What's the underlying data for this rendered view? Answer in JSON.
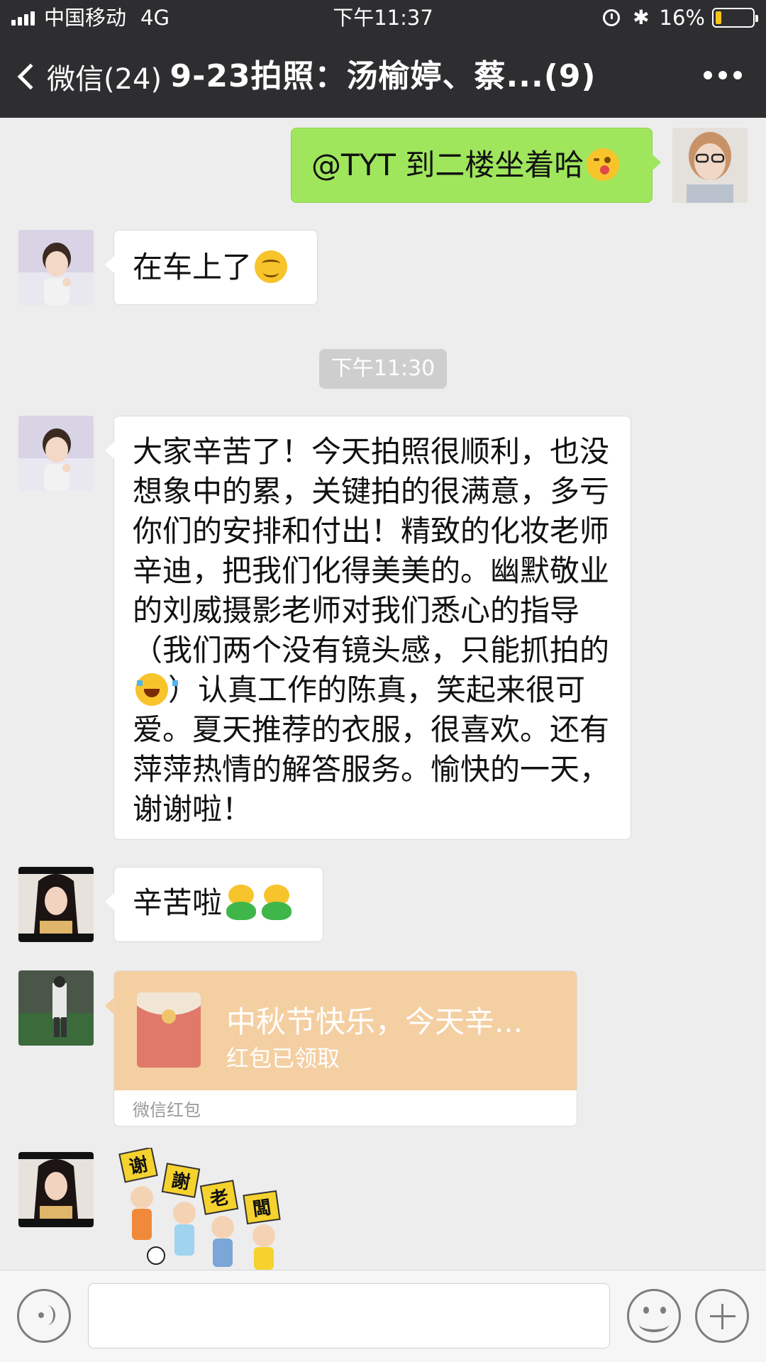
{
  "status_bar": {
    "carrier": "中国移动",
    "network": "4G",
    "time": "下午11:37",
    "battery": "16%",
    "battery_level": 0.16
  },
  "nav": {
    "back_label": "微信(24)",
    "title": "9-23拍照：汤榆婷、蔡...(9)"
  },
  "messages": {
    "m1": {
      "text": "@TYT 到二楼坐着哈",
      "emoji": "wink-tongue-icon"
    },
    "m2": {
      "text": "在车上了",
      "emoji": "smile-icon"
    },
    "timestamp": "下午11:30",
    "m3": {
      "text_before_emoji": "大家辛苦了！今天拍照很顺利，也没想象中的累，关键拍的很满意，多亏你们的安排和付出！精致的化妆老师辛迪，把我们化得美美的。幽默敬业的刘威摄影老师对我们悉心的指导（我们两个没有镜头感，只能抓拍的",
      "text_after_emoji": "）认真工作的陈真，笑起来很可爱。夏天推荐的衣服，很喜欢。还有萍萍热情的解答服务。愉快的一天，谢谢啦！",
      "emoji": "laugh-cry-icon"
    },
    "m4": {
      "text": "辛苦啦",
      "emoji": "frog-icon"
    },
    "red_packet": {
      "title": "中秋节快乐，今天辛...",
      "status": "红包已领取",
      "label": "微信红包"
    },
    "sticker": {
      "signs": [
        "谢",
        "謝",
        "老",
        "闆"
      ]
    }
  },
  "colors": {
    "nav_bg": "#2e2e31",
    "chat_bg": "#ededed",
    "my_bubble": "#9fe65c",
    "red_packet": "#f4cfa2"
  }
}
